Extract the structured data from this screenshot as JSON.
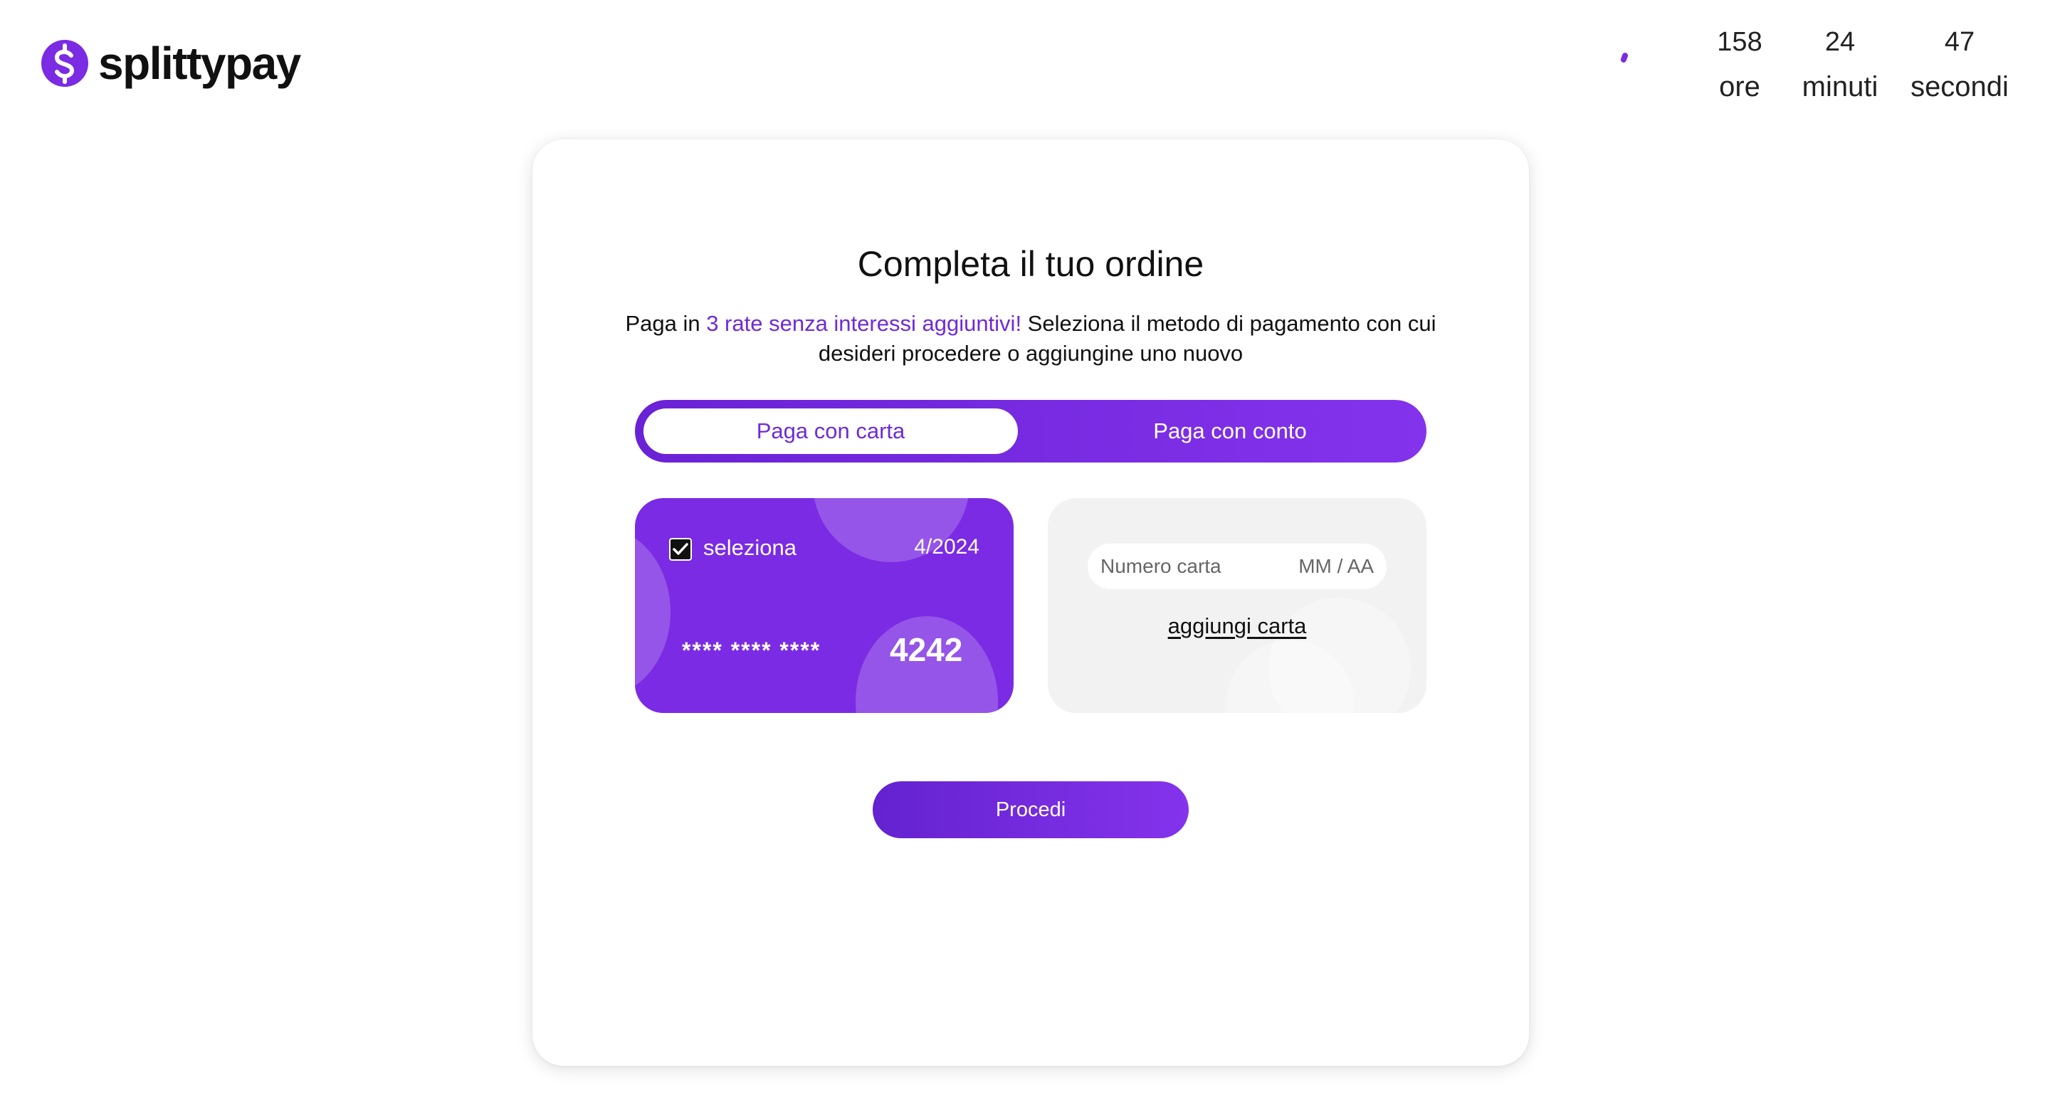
{
  "header": {
    "logo_text": "splittypay",
    "logo_icon": "dollar-circle-icon",
    "brand_color": "#7b2be3"
  },
  "countdown": {
    "hours_value": "158",
    "hours_label": "ore",
    "minutes_value": "24",
    "minutes_label": "minuti",
    "seconds_value": "47",
    "seconds_label": "secondi"
  },
  "checkout": {
    "title": "Completa il tuo ordine",
    "subtitle_prefix": "Paga in ",
    "subtitle_highlight": "3 rate senza interessi aggiuntivi!",
    "subtitle_suffix": " Seleziona il metodo di pagamento con cui desideri procedere o aggiungine uno nuovo",
    "tabs": [
      {
        "label": "Paga con carta",
        "active": true
      },
      {
        "label": "Paga con conto",
        "active": false
      }
    ],
    "saved_card": {
      "select_label": "seleziona",
      "selected": true,
      "expiry": "4/2024",
      "masked_number": "**** **** ****",
      "last4": "4242"
    },
    "add_card": {
      "number_placeholder": "Numero carta",
      "expiry_placeholder": "MM / AA",
      "link_label": "aggiungi carta"
    },
    "proceed_label": "Procedi"
  }
}
